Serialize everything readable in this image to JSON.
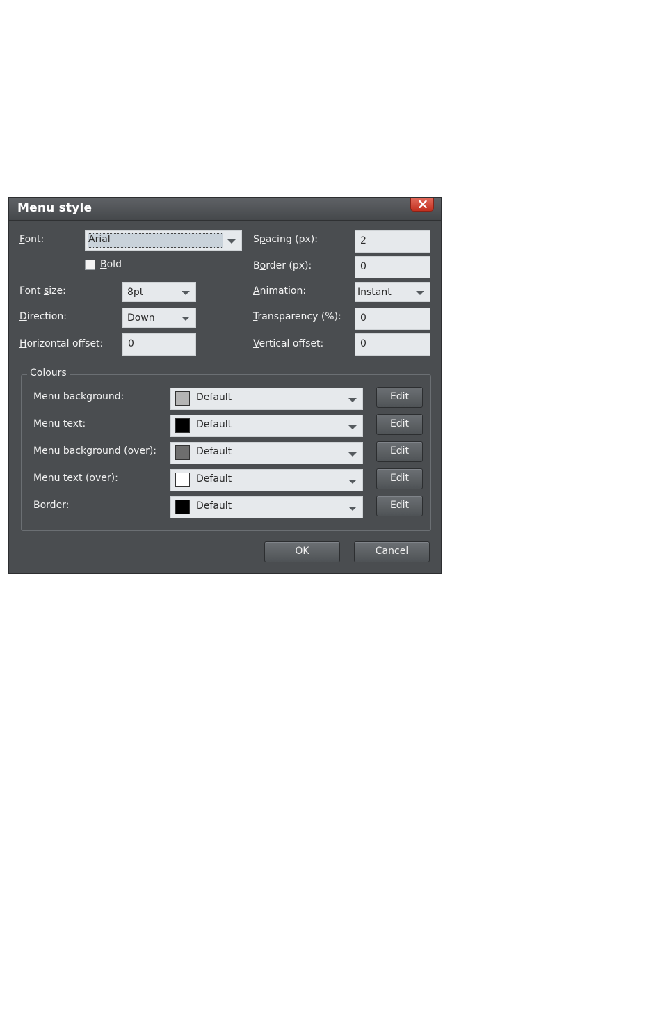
{
  "dialog": {
    "title": "Menu style",
    "close_label": "close"
  },
  "fields": {
    "font_label_first": "F",
    "font_label_rest": "ont:",
    "font_value": "Arial",
    "bold_label_first": "B",
    "bold_label_rest": "old",
    "bold_checked": false,
    "font_size_label_pre": "Font ",
    "font_size_label_u": "s",
    "font_size_label_rest": "ize:",
    "font_size_value": "8pt",
    "direction_label_first": "D",
    "direction_label_rest": "irection:",
    "direction_value": "Down",
    "horizontal_offset_label_first": "H",
    "horizontal_offset_label_rest": "orizontal offset:",
    "horizontal_offset_value": "0",
    "spacing_label_pre": "S",
    "spacing_label_u": "p",
    "spacing_label_rest": "acing (px):",
    "spacing_value": "2",
    "border_label_pre": "B",
    "border_label_u": "o",
    "border_label_rest": "rder (px):",
    "border_value": "0",
    "animation_label_first": "A",
    "animation_label_rest": "nimation:",
    "animation_value": "Instant",
    "transparency_label_first": "T",
    "transparency_label_rest": "ransparency (%):",
    "transparency_value": "0",
    "vertical_offset_label_first": "V",
    "vertical_offset_label_rest": "ertical offset:",
    "vertical_offset_value": "0"
  },
  "colours": {
    "group_title": "Colours",
    "rows": [
      {
        "label": "Menu background:",
        "value": "Default",
        "swatch": "#b4b4b4",
        "edit": "Edit"
      },
      {
        "label": "Menu text:",
        "value": "Default",
        "swatch": "#000000",
        "edit": "Edit"
      },
      {
        "label": "Menu background (over):",
        "value": "Default",
        "swatch": "#6e6e6e",
        "edit": "Edit"
      },
      {
        "label": "Menu text (over):",
        "value": "Default",
        "swatch": "#ffffff",
        "edit": "Edit"
      },
      {
        "label": "Border:",
        "value": "Default",
        "swatch": "#000000",
        "edit": "Edit"
      }
    ]
  },
  "buttons": {
    "ok": "OK",
    "cancel": "Cancel"
  },
  "icons": {
    "close": "close-x-icon",
    "dropdown": "chevron-down-icon"
  },
  "theme": {
    "dialog_bg": "#4a4d50",
    "field_bg": "#e6e9ec",
    "close_red": "#d04a3a"
  }
}
